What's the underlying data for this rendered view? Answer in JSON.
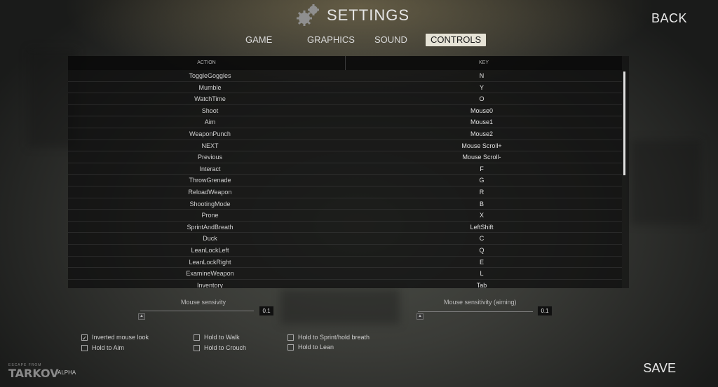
{
  "header": {
    "title": "SETTINGS",
    "back_label": "BACK"
  },
  "tabs": [
    {
      "label": "GAME",
      "active": false
    },
    {
      "label": "GRAPHICS",
      "active": false
    },
    {
      "label": "SOUND",
      "active": false
    },
    {
      "label": "CONTROLS",
      "active": true
    }
  ],
  "table": {
    "columns": {
      "action": "ACTION",
      "key": "KEY"
    },
    "rows": [
      {
        "action": "ToggleGoggles",
        "key": "N"
      },
      {
        "action": "Mumble",
        "key": "Y"
      },
      {
        "action": "WatchTime",
        "key": "O"
      },
      {
        "action": "Shoot",
        "key": "Mouse0"
      },
      {
        "action": "Aim",
        "key": "Mouse1"
      },
      {
        "action": "WeaponPunch",
        "key": "Mouse2"
      },
      {
        "action": "NEXT",
        "key": "Mouse Scroll+"
      },
      {
        "action": "Previous",
        "key": "Mouse Scroll-"
      },
      {
        "action": "Interact",
        "key": "F"
      },
      {
        "action": "ThrowGrenade",
        "key": "G"
      },
      {
        "action": "ReloadWeapon",
        "key": "R"
      },
      {
        "action": "ShootingMode",
        "key": "B"
      },
      {
        "action": "Prone",
        "key": "X"
      },
      {
        "action": "SprintAndBreath",
        "key": "LeftShift"
      },
      {
        "action": "Duck",
        "key": "C"
      },
      {
        "action": "LeanLockLeft",
        "key": "Q"
      },
      {
        "action": "LeanLockRight",
        "key": "E"
      },
      {
        "action": "ExamineWeapon",
        "key": "L"
      },
      {
        "action": "Inventory",
        "key": "Tab"
      }
    ]
  },
  "sensitivity": {
    "mouse_label": "Mouse sensivity",
    "mouse_value": "0.1",
    "aiming_label": "Mouse sensitivity (aiming)",
    "aiming_value": "0.1"
  },
  "options": {
    "inverted_mouse": {
      "label": "Inverted mouse look",
      "checked": true,
      "mark": "✓"
    },
    "hold_to_aim": {
      "label": "Hold to Aim",
      "checked": false
    },
    "hold_to_walk": {
      "label": "Hold to Walk",
      "checked": false
    },
    "hold_to_crouch": {
      "label": "Hold to Crouch",
      "checked": false
    },
    "hold_to_sprint": {
      "label": "Hold to Sprint/hold breath",
      "checked": false
    },
    "hold_to_lean": {
      "label": "Hold to Lean",
      "checked": false
    }
  },
  "footer": {
    "logo_top": "ESCAPE FROM",
    "logo_main": "TARKOV",
    "alpha_label": "ALPHA",
    "save_label": "SAVE"
  }
}
